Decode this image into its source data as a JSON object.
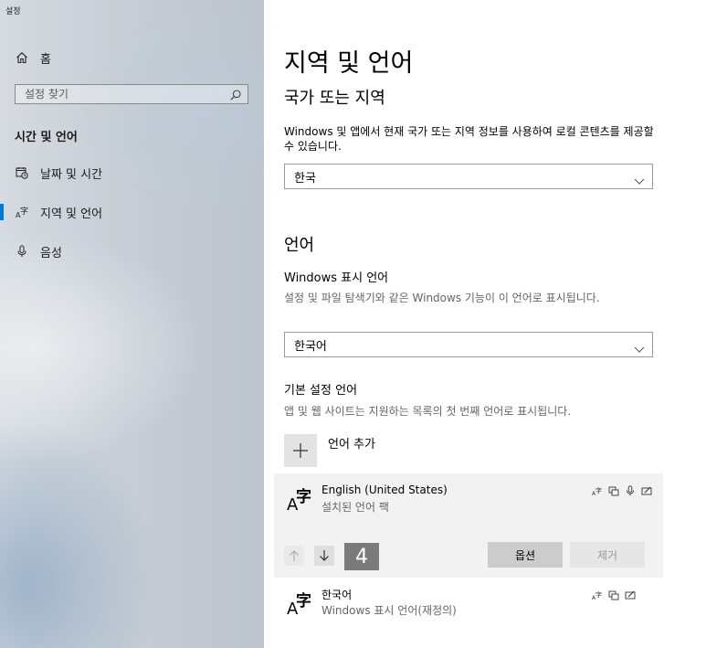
{
  "window": {
    "title": "설정"
  },
  "sidebar": {
    "home_label": "홈",
    "search_placeholder": "설정 찾기",
    "section_heading": "시간 및 언어",
    "items": [
      {
        "label": "날짜 및 시간",
        "icon": "calendar-clock-icon"
      },
      {
        "label": "지역 및 언어",
        "icon": "language-icon",
        "selected": true
      },
      {
        "label": "음성",
        "icon": "microphone-icon"
      }
    ]
  },
  "main": {
    "title": "지역 및 언어",
    "region": {
      "heading": "국가 또는 지역",
      "description": "Windows 및 앱에서 현재 국가 또는 지역 정보를 사용하여 로컬 콘텐츠를 제공할 수 있습니다.",
      "selected": "한국"
    },
    "language": {
      "heading": "언어",
      "display_label": "Windows 표시 언어",
      "display_description": "설정 및 파일 탐색기와 같은 Windows 기능이 이 언어로 표시됩니다.",
      "display_selected": "한국어",
      "preferred_label": "기본 설정 언어",
      "preferred_description": "앱 및 웹 사이트는 지원하는 목록의 첫 번째 언어로 표시됩니다.",
      "add_label": "언어 추가",
      "items": [
        {
          "name": "English (United States)",
          "status": "설치된 언어 팩",
          "order_badge": "4",
          "options_label": "옵션",
          "remove_label": "제거"
        },
        {
          "name": "한국어",
          "status": "Windows 표시 언어(재정의)"
        }
      ]
    }
  },
  "colors": {
    "accent": "#0078d7",
    "selected_item_bg": "#f2f2f2"
  }
}
